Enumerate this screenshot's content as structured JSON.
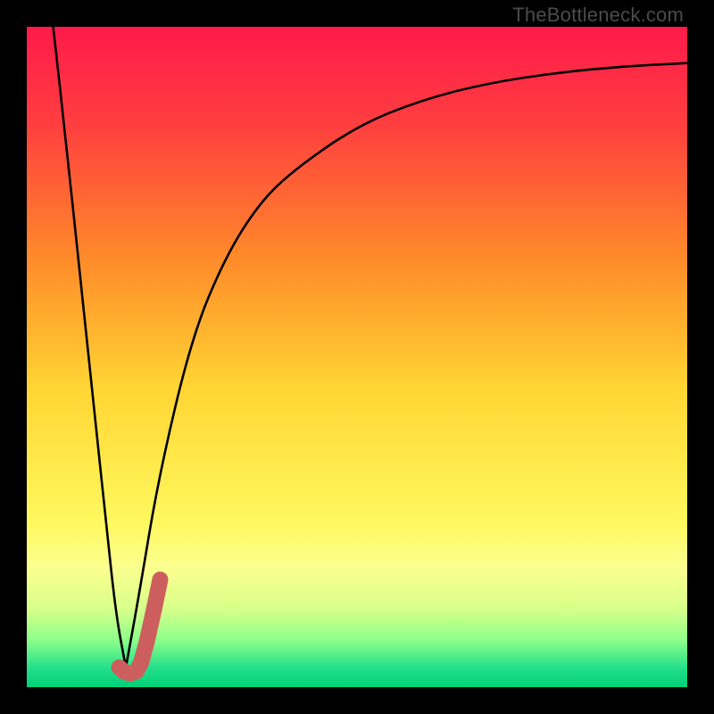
{
  "watermark": "TheBottleneck.com",
  "colors": {
    "frame": "#000000",
    "gradient_stops": [
      {
        "pos": 0.0,
        "color": "#ff1a4b"
      },
      {
        "pos": 0.15,
        "color": "#ff3f3f"
      },
      {
        "pos": 0.35,
        "color": "#ff8a2a"
      },
      {
        "pos": 0.55,
        "color": "#ffd633"
      },
      {
        "pos": 0.75,
        "color": "#fff85e"
      },
      {
        "pos": 0.82,
        "color": "#faff8f"
      },
      {
        "pos": 0.88,
        "color": "#d9ff8a"
      },
      {
        "pos": 0.93,
        "color": "#8aff8a"
      },
      {
        "pos": 0.97,
        "color": "#26e08a"
      },
      {
        "pos": 1.0,
        "color": "#00d07a"
      }
    ],
    "curve": "#000000",
    "marker": "#cc5f5e"
  },
  "chart_data": {
    "type": "line",
    "title": "",
    "xlabel": "",
    "ylabel": "",
    "xlim": [
      0,
      100
    ],
    "ylim": [
      0,
      100
    ],
    "series": [
      {
        "name": "left-branch",
        "x": [
          4,
          6,
          8,
          10,
          12,
          13.5,
          15
        ],
        "values": [
          100,
          82,
          63,
          44,
          25,
          11,
          3
        ]
      },
      {
        "name": "right-branch",
        "x": [
          15,
          17,
          20,
          25,
          30,
          35,
          40,
          50,
          60,
          70,
          80,
          90,
          100
        ],
        "values": [
          3,
          14,
          32,
          53,
          65,
          73,
          78,
          85,
          89,
          91.5,
          93,
          94,
          94.5
        ]
      }
    ],
    "marker": {
      "name": "j-shaped-marker",
      "points_xy": [
        [
          14.0,
          3.0
        ],
        [
          14.8,
          2.3
        ],
        [
          15.7,
          2.1
        ],
        [
          16.6,
          2.4
        ],
        [
          17.3,
          3.7
        ],
        [
          18.2,
          7.0
        ],
        [
          19.2,
          11.5
        ],
        [
          20.2,
          16.3
        ]
      ]
    }
  }
}
